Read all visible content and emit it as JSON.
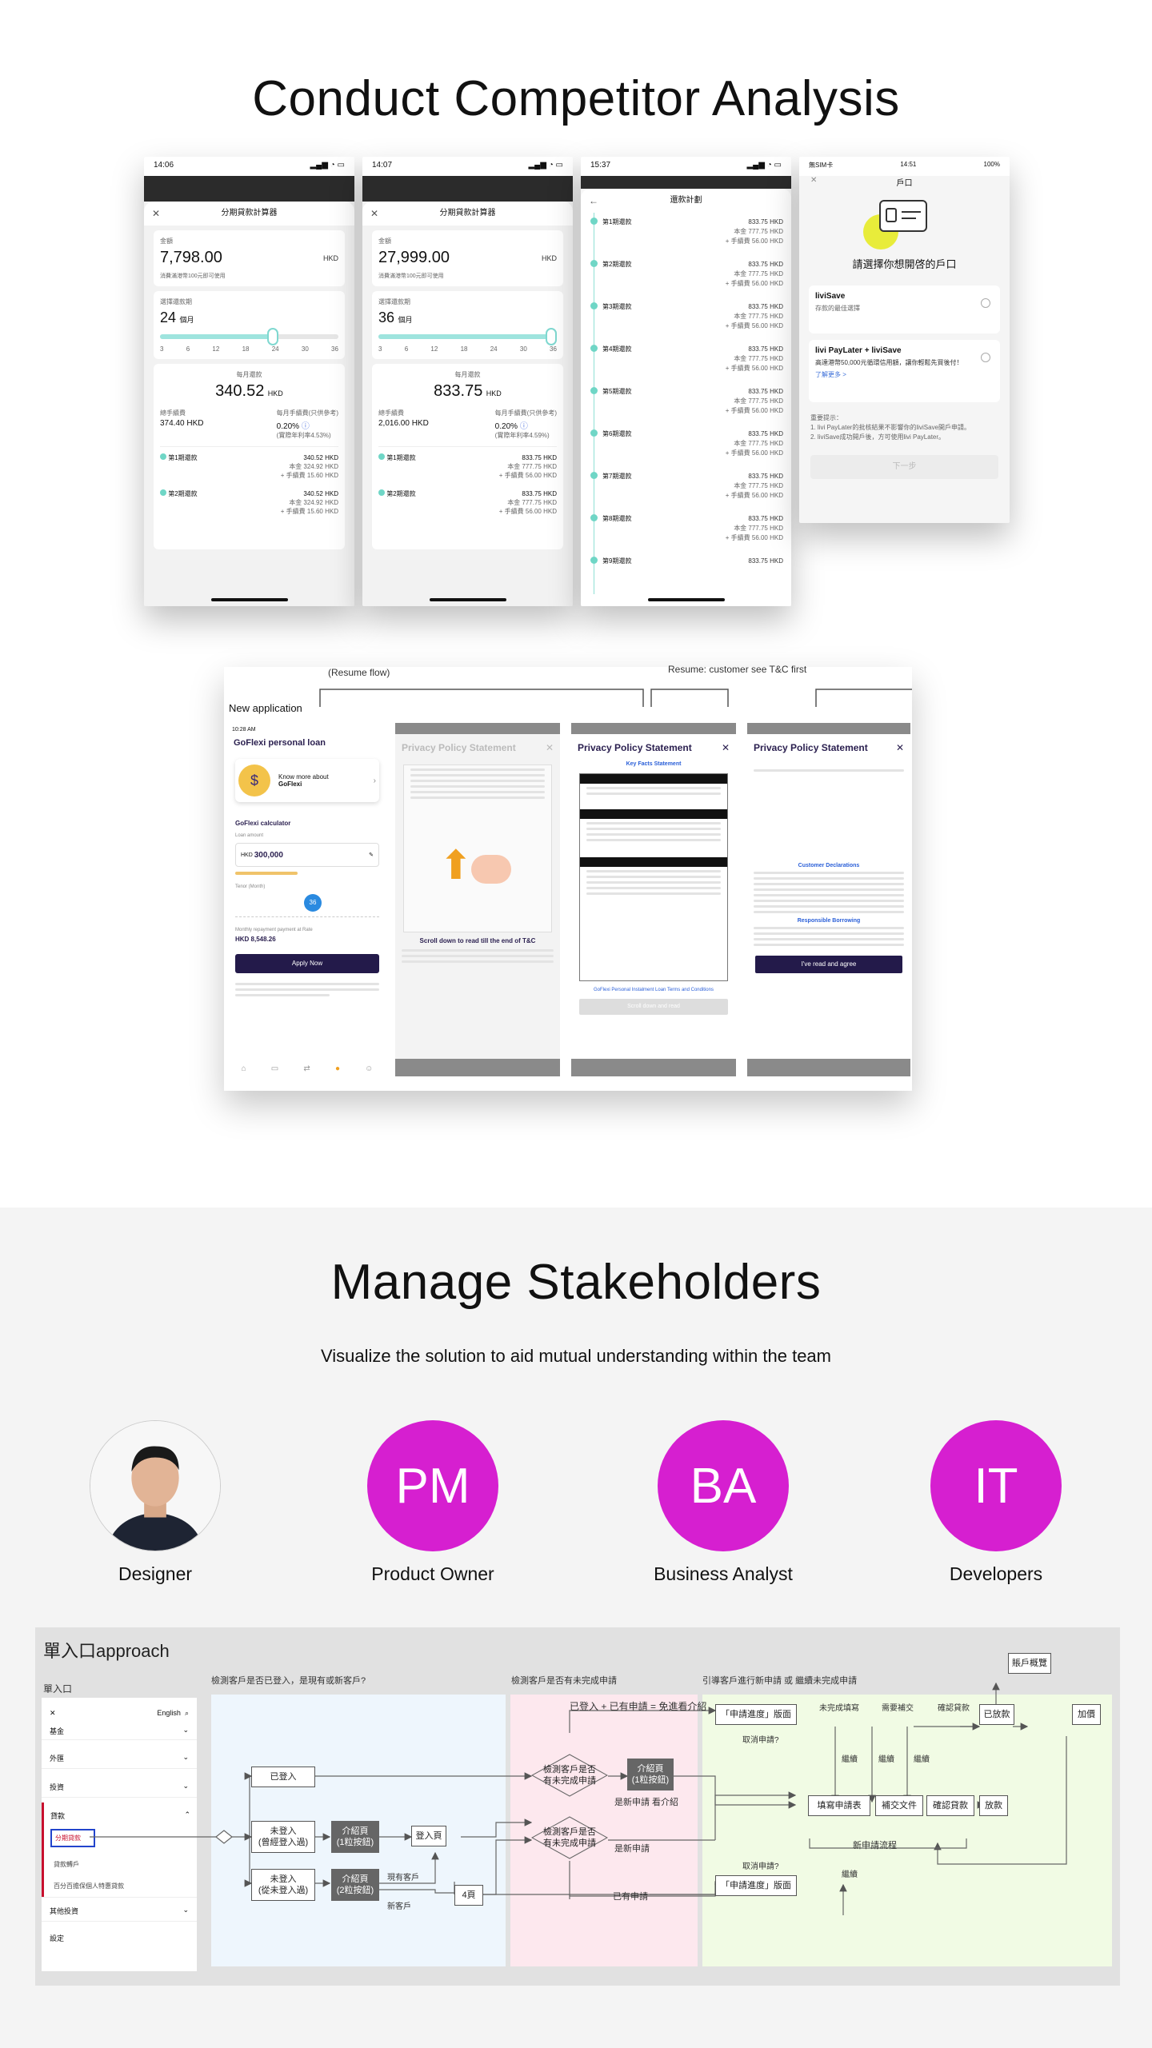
{
  "section1": {
    "title": "Conduct Competitor Analysis",
    "phones": [
      {
        "status_time": "14:06",
        "title": "分期貸款計算器",
        "amount_label": "金額",
        "amount": "7,798.00",
        "currency": "HKD",
        "amount_hint": "消費滿港幣100元即可使用",
        "tenor_label": "選擇還款期",
        "tenor_value": "24",
        "tenor_unit": "個月",
        "ticks": [
          "3",
          "6",
          "12",
          "18",
          "24",
          "30",
          "36"
        ],
        "monthly_label": "每月還款",
        "monthly_value": "340.52",
        "monthly_unit": "HKD",
        "fee_label": "總手續費",
        "fee_value": "374.40 HKD",
        "rate_label": "每月手續費(只供參考)",
        "rate_value": "0.20%",
        "apr": "(實際年利率4.53%)",
        "inst1_label": "第1期還款",
        "inst1_total": "340.52 HKD",
        "inst1_principal": "本金 324.92 HKD",
        "inst1_fee": "+ 手續費 15.60 HKD",
        "inst2_label": "第2期還款",
        "inst2_total": "340.52 HKD",
        "inst2_principal": "本金 324.92 HKD",
        "inst2_fee": "+ 手續費 15.60 HKD"
      },
      {
        "status_time": "14:07",
        "title": "分期貸款計算器",
        "amount_label": "金額",
        "amount": "27,999.00",
        "currency": "HKD",
        "amount_hint": "消費滿港幣100元即可使用",
        "tenor_label": "選擇還款期",
        "tenor_value": "36",
        "tenor_unit": "個月",
        "ticks": [
          "3",
          "6",
          "12",
          "18",
          "24",
          "30",
          "36"
        ],
        "monthly_label": "每月還款",
        "monthly_value": "833.75",
        "monthly_unit": "HKD",
        "fee_label": "總手續費",
        "fee_value": "2,016.00 HKD",
        "rate_label": "每月手續費(只供參考)",
        "rate_value": "0.20%",
        "apr": "(實際年利率4.59%)",
        "inst1_label": "第1期還款",
        "inst1_total": "833.75 HKD",
        "inst1_principal": "本金 777.75 HKD",
        "inst1_fee": "+ 手續費 56.00 HKD",
        "inst2_label": "第2期還款",
        "inst2_total": "833.75 HKD",
        "inst2_principal": "本金 777.75 HKD",
        "inst2_fee": "+ 手續費 56.00 HKD"
      }
    ],
    "plan_phone": {
      "status_time": "15:37",
      "title": "還款計劃",
      "rows": [
        {
          "label": "第1期還款",
          "total": "833.75 HKD",
          "principal": "本金 777.75 HKD",
          "fee": "+ 手續費 56.00 HKD"
        },
        {
          "label": "第2期還款",
          "total": "833.75 HKD",
          "principal": "本金 777.75 HKD",
          "fee": "+ 手續費 56.00 HKD"
        },
        {
          "label": "第3期還款",
          "total": "833.75 HKD",
          "principal": "本金 777.75 HKD",
          "fee": "+ 手續費 56.00 HKD"
        },
        {
          "label": "第4期還款",
          "total": "833.75 HKD",
          "principal": "本金 777.75 HKD",
          "fee": "+ 手續費 56.00 HKD"
        },
        {
          "label": "第5期還款",
          "total": "833.75 HKD",
          "principal": "本金 777.75 HKD",
          "fee": "+ 手續費 56.00 HKD"
        },
        {
          "label": "第6期還款",
          "total": "833.75 HKD",
          "principal": "本金 777.75 HKD",
          "fee": "+ 手續費 56.00 HKD"
        },
        {
          "label": "第7期還款",
          "total": "833.75 HKD",
          "principal": "本金 777.75 HKD",
          "fee": "+ 手續費 56.00 HKD"
        },
        {
          "label": "第8期還款",
          "total": "833.75 HKD",
          "principal": "本金 777.75 HKD",
          "fee": "+ 手續費 56.00 HKD"
        },
        {
          "label": "第9期還款",
          "total": "833.75 HKD",
          "principal": "",
          "fee": ""
        }
      ]
    },
    "account_phone": {
      "status_left": "無SIM卡",
      "status_time": "14:51",
      "status_right": "100%",
      "title": "戶口",
      "heading": "請選擇你想開啓的戶口",
      "opt1_title": "liviSave",
      "opt1_desc": "存款的最佳選擇",
      "opt2_title": "livi PayLater + liviSave",
      "opt2_desc": "高達港幣50,000元循環信用額，讓你輕鬆先買後付！",
      "opt2_link": "了解更多 >",
      "notes_title": "重要提示：",
      "note1": "1. livi PayLater的批核結果不影響你的liviSave開戶申請。",
      "note2": "2. liviSave成功開戶後，方可使用livi PayLater。",
      "next_btn": "下一步"
    },
    "flow": {
      "resume_flow": "(Resume flow)",
      "resume_tc": "Resume: customer see T&C first",
      "new_app": "New application",
      "app_time": "10:28 AM",
      "app_title": "GoFlexi personal loan",
      "promo_line1": "Know more about",
      "promo_line2": "GoFlexi",
      "calc_title": "GoFlexi calculator",
      "loan_amount_label": "Loan amount",
      "loan_currency": "HKD",
      "loan_amount": "300,000",
      "tenor_label": "Tenor (Month)",
      "tenor_value": "36",
      "monthly_label": "Monthly repayment payment at Rate",
      "monthly_value": "HKD 8,548.26",
      "apply_btn": "Apply Now",
      "pp_title": "Privacy Policy Statement",
      "scroll_hint": "Scroll down to read till the end of T&C",
      "kfs_title": "Key Facts Statement",
      "cust_decl": "Customer Declarations",
      "resp_borrow": "Responsible Borrowing",
      "tc_link": "GoFlexi Personal Instalment Loan Terms and Conditions",
      "scroll_btn": "Scroll down and read",
      "agree_btn": "I've read and agree"
    }
  },
  "section2": {
    "title": "Manage Stakeholders",
    "subtitle": "Visualize the solution to aid mutual understanding within the team",
    "personas": [
      {
        "initials": "",
        "label": "Designer"
      },
      {
        "initials": "PM",
        "label": "Product Owner"
      },
      {
        "initials": "BA",
        "label": "Business Analyst"
      },
      {
        "initials": "IT",
        "label": "Developers"
      }
    ],
    "persona_color": "#d61fd0"
  },
  "diagram": {
    "title": "單入口approach",
    "menu_title": "單入口",
    "menu_lang": "English",
    "menu_items": [
      "基金",
      "外匯",
      "投資",
      "貸款",
      "分期貸款",
      "貸款轉戶",
      "百分百擔保個人特惠貸款",
      "其他投資",
      "設定"
    ],
    "zone1_title": "檢測客戶是否已登入，是現有或新客戶?",
    "zone2_title": "檢測客戶是否有未完成申請",
    "zone3_title": "引導客戶進行新申請 或 繼續未完成申請",
    "n_logged": "已登入",
    "n_notlogged_existing": "未登入\n(曾經登入過)",
    "n_notlogged_new": "未登入\n(從未登入過)",
    "n_intro1": "介紹頁\n(1粒按鈕)",
    "n_intro2": "介紹頁\n(2粒按鈕)",
    "n_login": "登入頁",
    "n_4": "4頁",
    "l_existing": "現有客戶",
    "l_new": "新客戶",
    "n_check1": "檢測客戶是否\n有未完成申請",
    "n_check2": "檢測客戶是否\n有未完成申請",
    "n_intro3": "介紹頁\n(1粒按鈕)",
    "l_new_app_intro": "是新申請 看介紹",
    "l_new_app": "是新申請",
    "l_existing_app": "已有申請",
    "l_top": "已登入 + 已有申請 = 免進看介紹",
    "n_progress1": "「申請進度」版面",
    "n_progress2": "「申請進度」版面",
    "l_cancel1": "取消申請?",
    "l_cancel2": "取消申請?",
    "l_continue": "繼續",
    "l_unfinished": "未完成填寫",
    "l_need_supp": "需要補交",
    "l_confirm": "確認貸款",
    "n_fill": "填寫申請表",
    "n_supp": "補交文件",
    "n_confirm": "確認貸款",
    "n_disburse": "放款",
    "n_disbursed": "已放款",
    "n_topup": "加價",
    "n_account": "賬戶概覽",
    "l_new_flow": "新申請流程"
  }
}
